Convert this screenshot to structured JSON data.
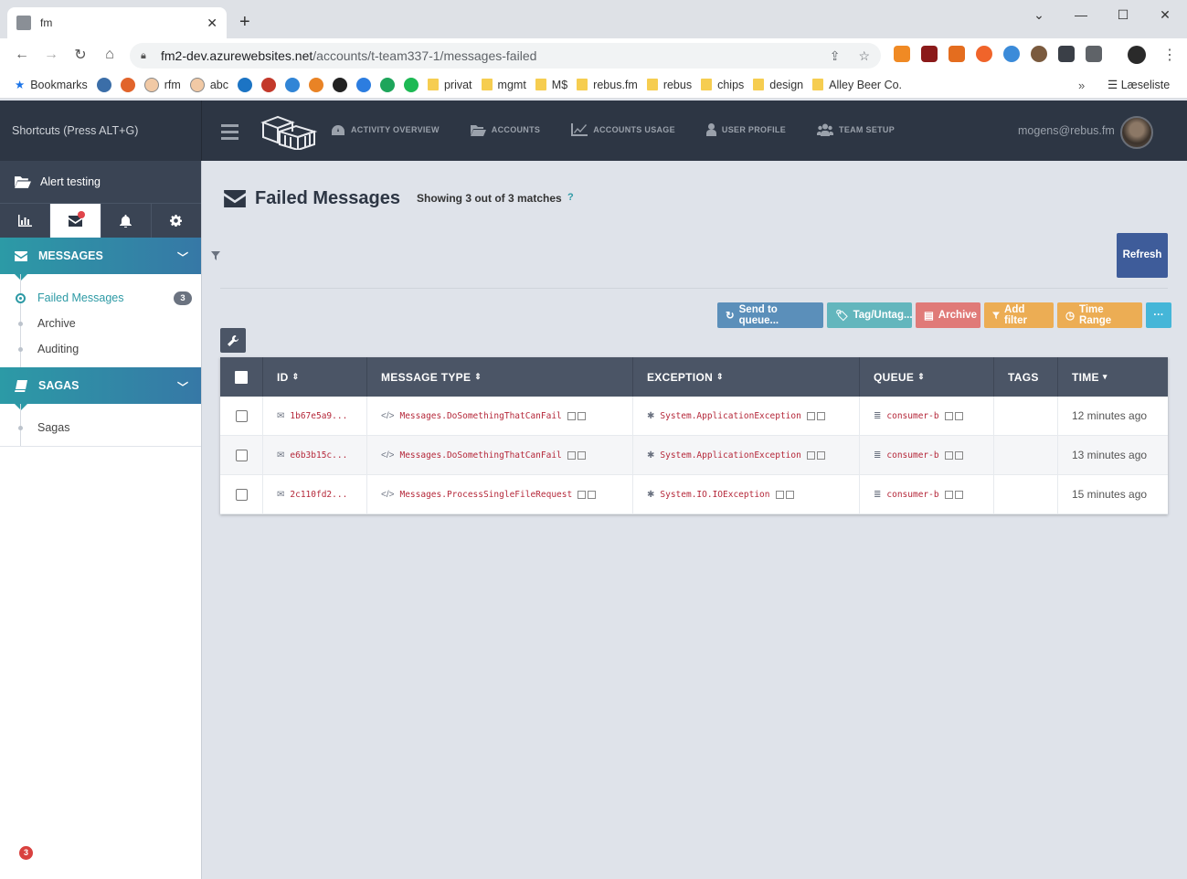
{
  "browser": {
    "tab_title": "fm",
    "tab_close": "✕",
    "new_tab": "+",
    "url_host": "fm2-dev.azurewebsites.net",
    "url_path": "/accounts/t-team337-1/messages-failed",
    "window_controls": [
      "⌄",
      "—",
      "☐",
      "✕"
    ],
    "bookmarks": [
      {
        "label": "Bookmarks",
        "type": "star"
      },
      {
        "label": "",
        "type": "icon",
        "color": "#3b6ea8"
      },
      {
        "label": "",
        "type": "icon",
        "color": "#e1642b"
      },
      {
        "label": "rfm",
        "type": "face"
      },
      {
        "label": "abc",
        "type": "face"
      },
      {
        "label": "",
        "type": "icon",
        "color": "#1c74c4"
      },
      {
        "label": "",
        "type": "icon",
        "color": "#c3392b"
      },
      {
        "label": "",
        "type": "icon",
        "color": "#3185d6"
      },
      {
        "label": "",
        "type": "icon",
        "color": "#e98325"
      },
      {
        "label": "",
        "type": "icon",
        "color": "#222222"
      },
      {
        "label": "",
        "type": "icon",
        "color": "#2c7de0"
      },
      {
        "label": "",
        "type": "icon",
        "color": "#1ea55b"
      },
      {
        "label": "",
        "type": "icon",
        "color": "#1db954"
      },
      {
        "label": "privat",
        "type": "folder"
      },
      {
        "label": "mgmt",
        "type": "folder"
      },
      {
        "label": "M$",
        "type": "folder"
      },
      {
        "label": "rebus.fm",
        "type": "folder"
      },
      {
        "label": "rebus",
        "type": "folder"
      },
      {
        "label": "chips",
        "type": "folder"
      },
      {
        "label": "design",
        "type": "folder"
      },
      {
        "label": "Alley Beer Co.",
        "type": "folder"
      }
    ],
    "bookmarks_more": "»",
    "reading_list": "Læseliste"
  },
  "header": {
    "shortcuts": "Shortcuts (Press ALT+G)",
    "nav": [
      {
        "label": "ACTIVITY OVERVIEW",
        "icon": "dashboard-icon"
      },
      {
        "label": "ACCOUNTS",
        "icon": "folder-open-icon"
      },
      {
        "label": "ACCOUNTS USAGE",
        "icon": "line-chart-icon"
      },
      {
        "label": "USER PROFILE",
        "icon": "user-icon"
      },
      {
        "label": "TEAM SETUP",
        "icon": "users-icon"
      }
    ],
    "user_email": "mogens@rebus.fm"
  },
  "sidebar": {
    "account": "Alert testing",
    "messages_section": "MESSAGES",
    "messages_items": [
      {
        "label": "Failed Messages",
        "active": true,
        "count": "3"
      },
      {
        "label": "Archive",
        "active": false
      },
      {
        "label": "Auditing",
        "active": false
      }
    ],
    "sagas_section": "SAGAS",
    "sagas_items": [
      {
        "label": "Sagas",
        "active": false
      }
    ],
    "alert_count": "3"
  },
  "main": {
    "title": "Failed Messages",
    "showing": "Showing 3 out of 3 matches",
    "help": "?",
    "refresh": "Refresh",
    "actions": {
      "send_to_queue": "Send to queue...",
      "tag_untag": "Tag/Untag...",
      "archive": "Archive",
      "add_filter": "Add filter",
      "time_range": "Time Range",
      "more": "···"
    },
    "columns": {
      "id": "ID",
      "message_type": "MESSAGE TYPE",
      "exception": "EXCEPTION",
      "queue": "QUEUE",
      "tags": "TAGS",
      "time": "TIME"
    },
    "rows": [
      {
        "id": "1b67e5a9...",
        "type": "Messages.DoSomethingThatCanFail",
        "exception": "System.ApplicationException",
        "queue": "consumer-b",
        "tags": "",
        "time": "12 minutes ago"
      },
      {
        "id": "e6b3b15c...",
        "type": "Messages.DoSomethingThatCanFail",
        "exception": "System.ApplicationException",
        "queue": "consumer-b",
        "tags": "",
        "time": "13 minutes ago"
      },
      {
        "id": "2c110fd2...",
        "type": "Messages.ProcessSingleFileRequest",
        "exception": "System.IO.IOException",
        "queue": "consumer-b",
        "tags": "",
        "time": "15 minutes ago"
      }
    ]
  },
  "colors": {
    "header_bg": "#2d3644",
    "accent_teal": "#2d9aa5",
    "refresh_blue": "#3e5c9a",
    "mono_red": "#b5283a"
  }
}
